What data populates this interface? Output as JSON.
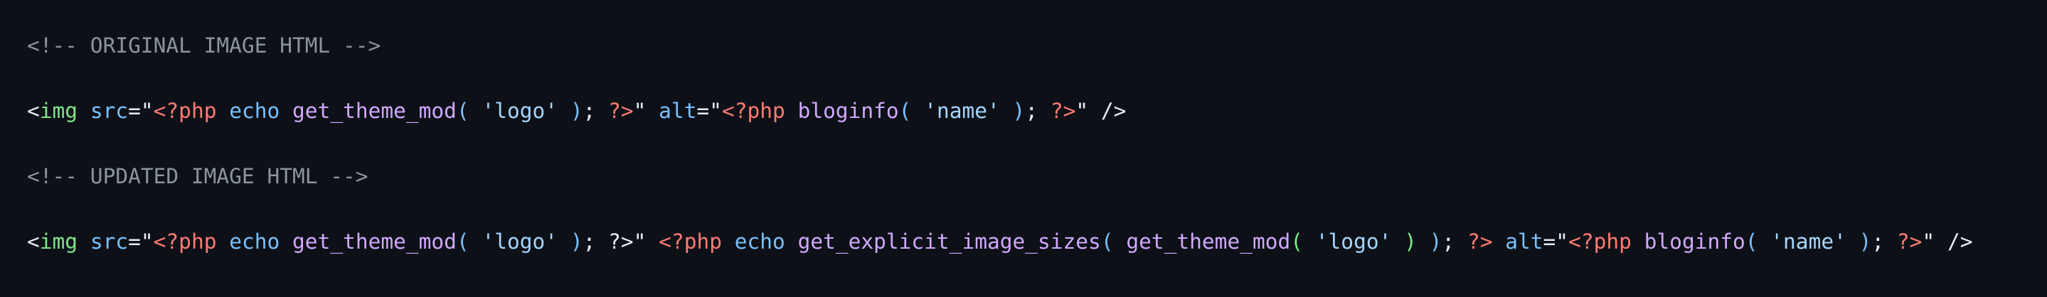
{
  "code": {
    "comment_original": "<!-- ORIGINAL IMAGE HTML -->",
    "comment_updated": "<!-- UPDATED IMAGE HTML -->",
    "tokens": {
      "lt": "<",
      "img": "img",
      "sp": " ",
      "src": "src",
      "eq_quote": "=\"",
      "php_open": "<?php",
      "echo": "echo",
      "get_theme_mod": "get_theme_mod",
      "paren_open": "(",
      "paren_close": ")",
      "logo_str": "'logo'",
      "semicolon": ";",
      "php_close": "?>",
      "quote": "\"",
      "alt": "alt",
      "bloginfo": "bloginfo",
      "name_str": "'name'",
      "self_close": "/>",
      "get_explicit_image_sizes": "get_explicit_image_sizes"
    }
  },
  "colors": {
    "background": "#0d1117",
    "comment": "#8b949e",
    "tag": "#7ee787",
    "attribute": "#79c0ff",
    "php_delimiter": "#ff7b72",
    "function": "#d2a8ff",
    "string": "#a5d6ff",
    "text": "#e6edf3"
  }
}
